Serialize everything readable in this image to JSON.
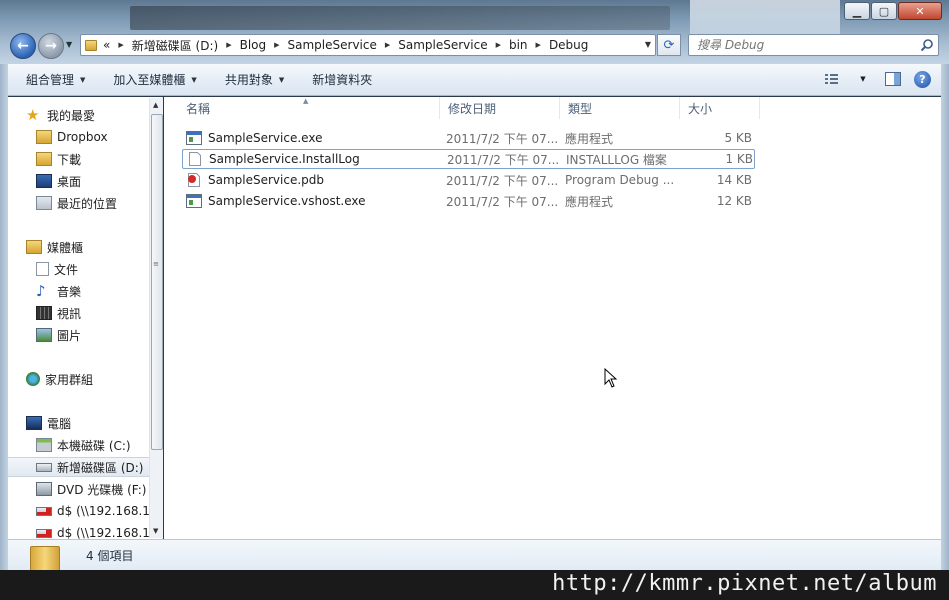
{
  "address": {
    "overflow": "«",
    "segments": [
      "新增磁碟區 (D:)",
      "Blog",
      "SampleService",
      "SampleService",
      "bin",
      "Debug"
    ]
  },
  "search": {
    "placeholder": "搜尋 Debug"
  },
  "toolbar": {
    "organize": "組合管理",
    "include_library": "加入至媒體櫃",
    "share_with": "共用對象",
    "new_folder": "新增資料夾"
  },
  "navpane": {
    "favorites": "我的最愛",
    "dropbox": "Dropbox",
    "downloads": "下載",
    "desktop": "桌面",
    "recent": "最近的位置",
    "libraries": "媒體櫃",
    "documents": "文件",
    "music": "音樂",
    "videos": "視訊",
    "pictures": "圖片",
    "homegroup": "家用群組",
    "computer": "電腦",
    "drive_c": "本機磁碟 (C:)",
    "drive_d": "新增磁碟區 (D:)",
    "drive_f": "DVD 光碟機 (F:) (",
    "net1": "d$ (\\\\192.168.1.",
    "net2": "d$ (\\\\192.168.1."
  },
  "columns": {
    "name": "名稱",
    "date": "修改日期",
    "type": "類型",
    "size": "大小"
  },
  "files": [
    {
      "name": "SampleService.exe",
      "date": "2011/7/2 下午 07...",
      "type": "應用程式",
      "size": "5 KB"
    },
    {
      "name": "SampleService.InstallLog",
      "date": "2011/7/2 下午 07...",
      "type": "INSTALLLOG 檔案",
      "size": "1 KB"
    },
    {
      "name": "SampleService.pdb",
      "date": "2011/7/2 下午 07...",
      "type": "Program Debug ...",
      "size": "14 KB"
    },
    {
      "name": "SampleService.vshost.exe",
      "date": "2011/7/2 下午 07...",
      "type": "應用程式",
      "size": "12 KB"
    }
  ],
  "status": {
    "item_count": "4 個項目"
  },
  "watermark": "http://kmmr.pixnet.net/album",
  "colors": {
    "accent": "#2b63b4",
    "selection_border": "#7da2ce",
    "toolbar_bg": "#e6eef6"
  }
}
